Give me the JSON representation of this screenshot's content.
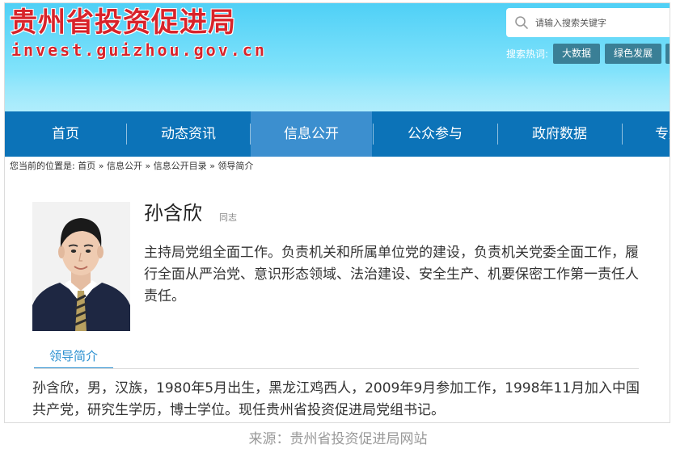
{
  "header": {
    "logo_cn": "贵州省投资促进局",
    "logo_en": "invest.guizhou.gov.cn",
    "search": {
      "placeholder": "请输入搜索关键字"
    },
    "hot_label": "搜索热词:",
    "hot_tags": [
      "大数据",
      "绿色发展"
    ]
  },
  "nav": {
    "items": [
      {
        "label": "首页"
      },
      {
        "label": "动态资讯"
      },
      {
        "label": "信息公开",
        "active": true
      },
      {
        "label": "公众参与"
      },
      {
        "label": "政府数据"
      },
      {
        "label": "专题"
      }
    ]
  },
  "breadcrumb": {
    "prefix": "您当前的位置是:",
    "items": [
      "首页",
      "信息公开",
      "信息公开目录",
      "领导简介"
    ],
    "separator": "»"
  },
  "profile": {
    "name": "孙含欣",
    "title_tag": "同志",
    "duty": "主持局党组全面工作。负责机关和所属单位党的建设，负责机关党委全面工作，履行全面从严治党、意识形态领域、法治建设、安全生产、机要保密工作第一责任人责任。",
    "tab_label": "领导简介",
    "bio": "孙含欣，男，汉族，1980年5月出生，黑龙江鸡西人，2009年9月参加工作，1998年11月加入中国共产党，研究生学历，博士学位。现任贵州省投资促进局党组书记。"
  },
  "caption": "来源：贵州省投资促进局网站",
  "colors": {
    "brand_red": "#d8232a",
    "nav_blue": "#0c73b8",
    "nav_active": "#3c8fcf",
    "tab_blue": "#2a8fd0",
    "hot_tag_bg": "#3a7f96"
  }
}
